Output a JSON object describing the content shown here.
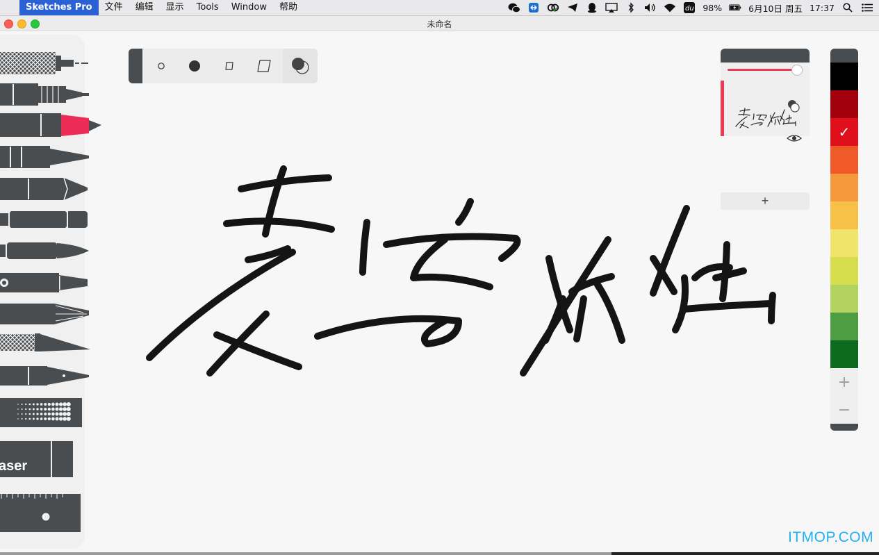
{
  "menubar": {
    "apple_symbol": "",
    "app_name": "Sketches Pro",
    "items": [
      "文件",
      "编辑",
      "显示",
      "Tools",
      "Window",
      "帮助"
    ],
    "battery": "98%",
    "datetime": "6月10日 周五",
    "time": "17:37"
  },
  "window": {
    "title": "未命名"
  },
  "tools": {
    "eraser_label": "aser"
  },
  "layers": {
    "add_symbol": "+",
    "thumbnail_text": "麦安狐独"
  },
  "palette": {
    "colors": [
      "#000000",
      "#a3000e",
      "#df101b",
      "#f05a28",
      "#f49a3c",
      "#f6c146",
      "#f1e46b",
      "#d6de4e",
      "#b2d360",
      "#4d9e42",
      "#0d6a1f"
    ],
    "selected_index": 2,
    "check_symbol": "✓",
    "plus_symbol": "+",
    "minus_symbol": "−"
  },
  "watermark": "ITMOP.COM"
}
